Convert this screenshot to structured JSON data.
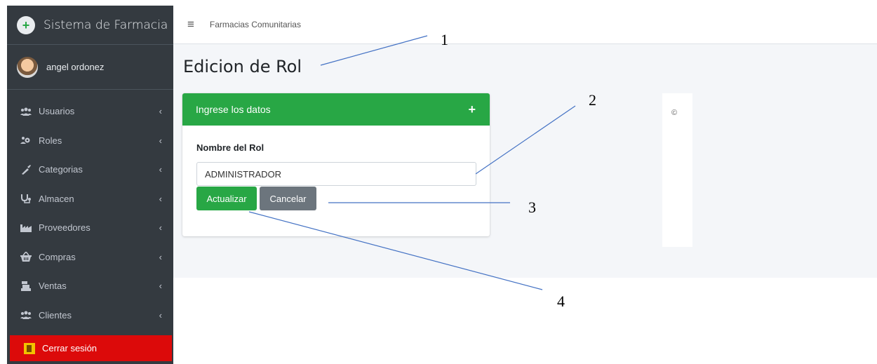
{
  "sidebar": {
    "brand": "Sistema de Farmacia",
    "user_name": "angel ordonez",
    "items": [
      {
        "label": "Usuarios",
        "icon": "users-icon"
      },
      {
        "label": "Roles",
        "icon": "user-cog-icon"
      },
      {
        "label": "Categorias",
        "icon": "syringe-icon"
      },
      {
        "label": "Almacen",
        "icon": "stethoscope-icon"
      },
      {
        "label": "Proveedores",
        "icon": "industry-icon"
      },
      {
        "label": "Compras",
        "icon": "basket-icon"
      },
      {
        "label": "Ventas",
        "icon": "cash-register-icon"
      },
      {
        "label": "Clientes",
        "icon": "users-icon"
      }
    ],
    "logout": "Cerrar sesión"
  },
  "topbar": {
    "breadcrumb": "Farmacias Comunitarias"
  },
  "main": {
    "page_title": "Edicion de Rol",
    "card": {
      "header": "Ingrese los datos",
      "field_label": "Nombre del Rol",
      "field_value": "ADMINISTRADOR",
      "update_button": "Actualizar",
      "cancel_button": "Cancelar"
    },
    "copyright": "©"
  },
  "annotations": {
    "n1": "1",
    "n2": "2",
    "n3": "3",
    "n4": "4"
  },
  "colors": {
    "sidebar_bg": "#343a40",
    "header_green": "#28a745",
    "logout_red": "#dc0a0a",
    "cancel_gray": "#6c757d"
  }
}
